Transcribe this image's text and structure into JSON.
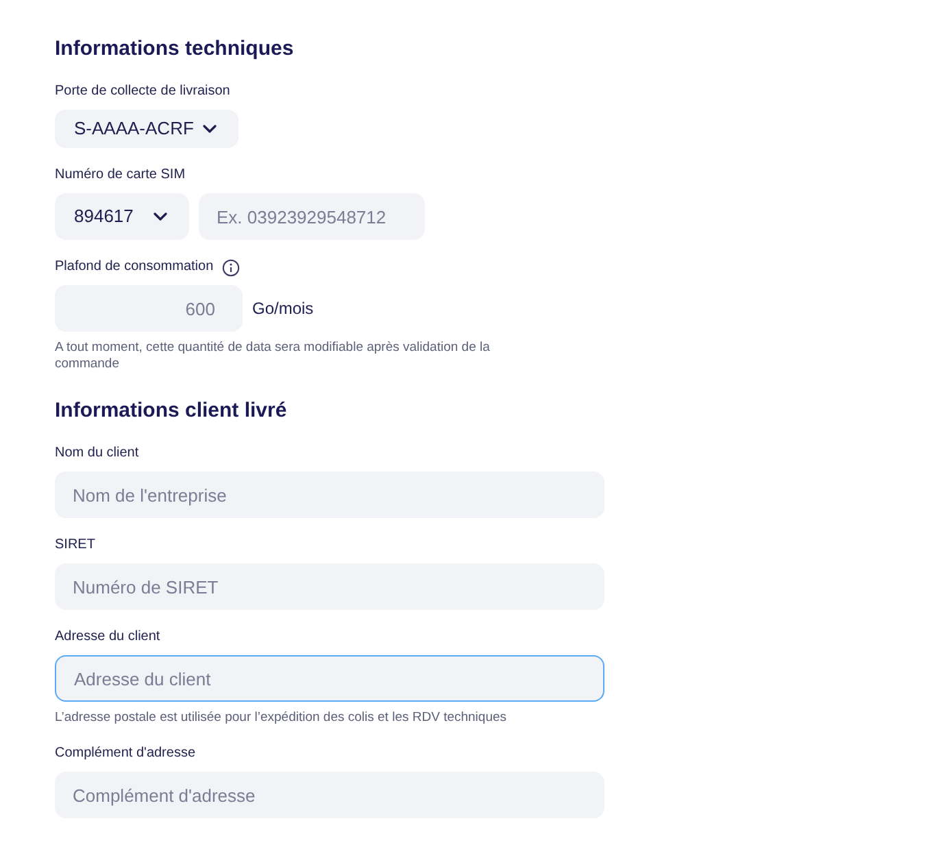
{
  "sections": [
    {
      "title": "Informations techniques",
      "fields": [
        {
          "kind": "select",
          "label": "Porte de collecte de livraison",
          "value": "S-AAAA-ACRF"
        },
        {
          "kind": "sim",
          "label": "Numéro de carte SIM",
          "value": "894617",
          "placeholder": "Ex. 03923929548712"
        },
        {
          "kind": "quantity",
          "label": "Plafond de consommation",
          "info": true,
          "placeholder": "600",
          "unit": "Go/mois",
          "hint": "A tout moment, cette quantité de data sera modifiable après validation de la commande"
        }
      ]
    },
    {
      "title": "Informations client livré",
      "fields": [
        {
          "kind": "text",
          "label": "Nom du client",
          "placeholder": "Nom de l'entreprise",
          "focused": false
        },
        {
          "kind": "text",
          "label": "SIRET",
          "placeholder": "Numéro de SIRET",
          "focused": false
        },
        {
          "kind": "text",
          "label": "Adresse du client",
          "placeholder": "Adresse du client",
          "focused": true,
          "hint": "L’adresse postale est utilisée pour l’expédition des colis et les RDV techniques"
        },
        {
          "kind": "text",
          "label": "Complément d'adresse",
          "placeholder": "Complément d'adresse",
          "focused": false
        }
      ]
    }
  ]
}
